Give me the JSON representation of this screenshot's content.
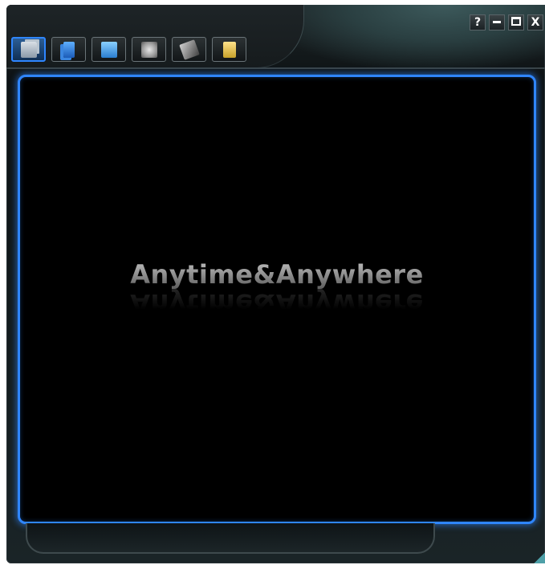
{
  "window": {
    "accent_color": "#2f86ff",
    "frame_color": "#141a1c"
  },
  "toolbar": {
    "buttons": [
      {
        "icon": "document-viewer-icon",
        "active": true
      },
      {
        "icon": "pages-icon",
        "active": false
      },
      {
        "icon": "folder-icon",
        "active": false
      },
      {
        "icon": "network-icon",
        "active": false
      },
      {
        "icon": "tools-icon",
        "active": false
      },
      {
        "icon": "info-icon",
        "active": false
      }
    ]
  },
  "controls": {
    "help_label": "?",
    "close_label": "X"
  },
  "screen": {
    "slogan": "Anytime&Anywhere"
  }
}
